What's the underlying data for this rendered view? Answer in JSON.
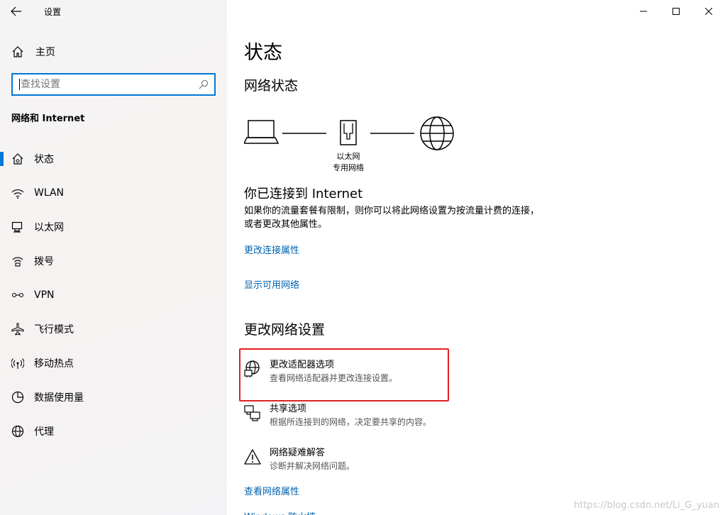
{
  "window": {
    "title": "设置"
  },
  "sidebar": {
    "home_label": "主页",
    "search_placeholder": "查找设置",
    "section_title": "网络和 Internet",
    "items": [
      {
        "label": "状态",
        "icon": "home-network-icon",
        "active": true
      },
      {
        "label": "WLAN",
        "icon": "wifi-icon"
      },
      {
        "label": "以太网",
        "icon": "ethernet-icon"
      },
      {
        "label": "拨号",
        "icon": "dialup-icon"
      },
      {
        "label": "VPN",
        "icon": "vpn-icon"
      },
      {
        "label": "飞行模式",
        "icon": "airplane-icon"
      },
      {
        "label": "移动热点",
        "icon": "hotspot-icon"
      },
      {
        "label": "数据使用量",
        "icon": "data-usage-icon"
      },
      {
        "label": "代理",
        "icon": "globe-icon"
      }
    ]
  },
  "main": {
    "title": "状态",
    "network_status_title": "网络状态",
    "diagram": {
      "label1": "以太网",
      "label2": "专用网络"
    },
    "connected_title": "你已连接到 Internet",
    "connected_desc": "如果你的流量套餐有限制，则你可以将此网络设置为按流量计费的连接，或者更改其他属性。",
    "link_change_props": "更改连接属性",
    "link_show_networks": "显示可用网络",
    "change_settings_title": "更改网络设置",
    "options": [
      {
        "title": "更改适配器选项",
        "desc": "查看网络适配器并更改连接设置。",
        "icon": "adapter-icon"
      },
      {
        "title": "共享选项",
        "desc": "根据所连接到的网络，决定要共享的内容。",
        "icon": "sharing-icon"
      },
      {
        "title": "网络疑难解答",
        "desc": "诊断并解决网络问题。",
        "icon": "warning-icon"
      }
    ],
    "link_view_props": "查看网络属性",
    "link_cut": "Windows 防火墙"
  },
  "watermark": "https://blog.csdn.net/Li_G_yuan",
  "colors": {
    "accent": "#0078d7",
    "link": "#0063b1",
    "highlight": "#e02020"
  }
}
